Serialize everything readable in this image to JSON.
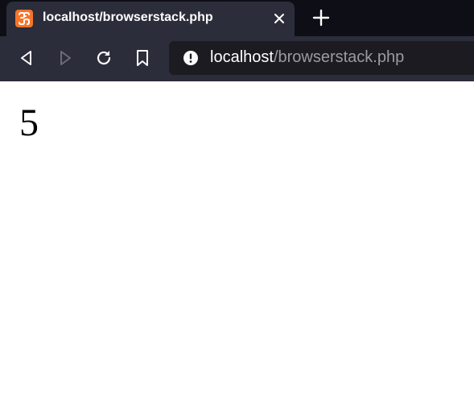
{
  "tab": {
    "title": "localhost/browserstack.php",
    "favicon": "xampp-icon",
    "favicon_color": "#f7742a"
  },
  "toolbar": {
    "back_icon": "back-arrow-icon",
    "forward_icon": "forward-arrow-icon",
    "reload_icon": "reload-icon",
    "bookmark_icon": "bookmark-icon"
  },
  "url": {
    "host": "localhost",
    "path": "/browserstack.php",
    "info_icon": "site-info-icon"
  },
  "page": {
    "content": "5"
  },
  "colors": {
    "tab_strip": "#0e0e16",
    "toolbar": "#2b2d3a",
    "url_bar": "#1c1b22",
    "url_path": "#9b9aa3"
  }
}
